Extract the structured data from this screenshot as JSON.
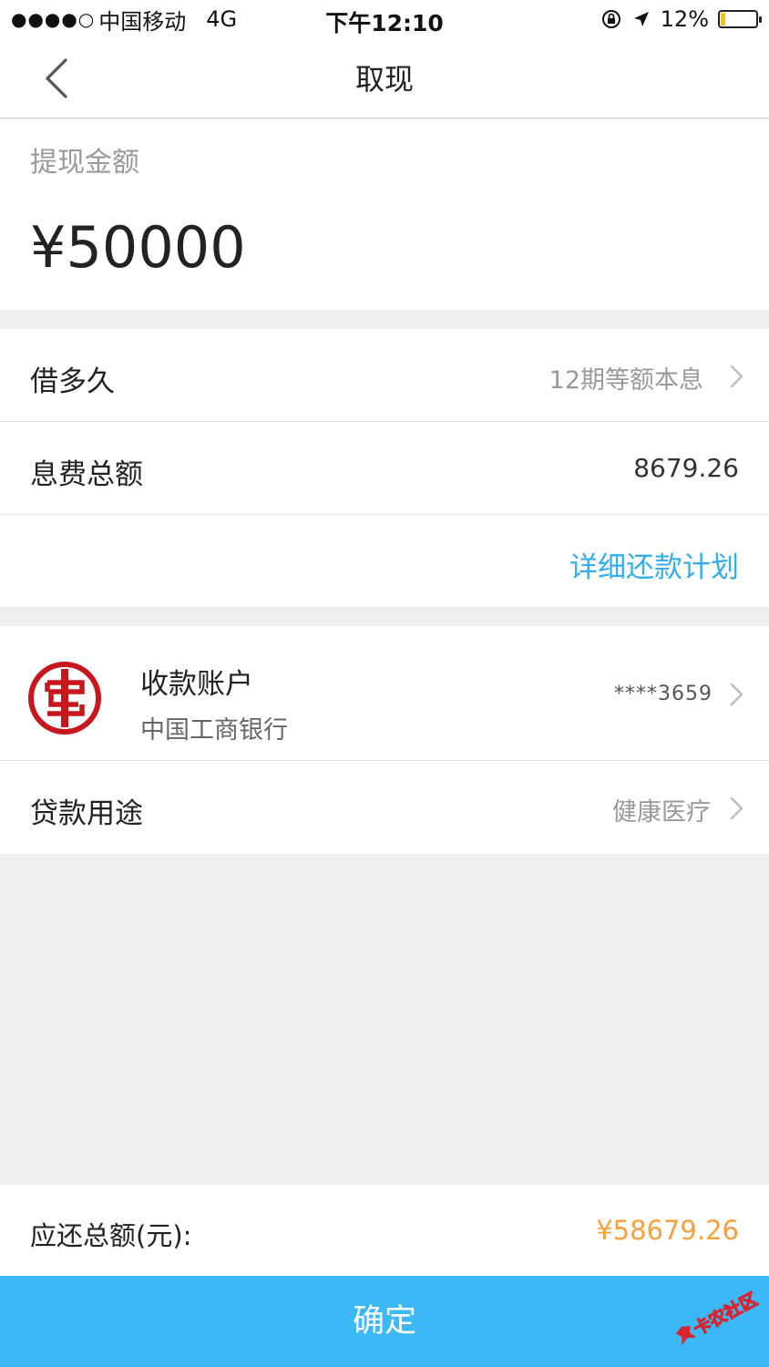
{
  "status_bar": {
    "signal": "●●●●○",
    "carrier": "中国移动",
    "network": "4G",
    "time": "下午12:10",
    "battery_percent": "12%",
    "battery_level": 0.12
  },
  "nav": {
    "title": "取现"
  },
  "withdraw": {
    "label": "提现金额",
    "amount": "¥50000"
  },
  "loan_info": {
    "term_label": "借多久",
    "term_value": "12期等额本息",
    "interest_label": "息费总额",
    "interest_value": "8679.26",
    "plan_link": "详细还款计划"
  },
  "account": {
    "label": "收款账户",
    "bank_name": "中国工商银行",
    "account_number": "****3659",
    "bank_logo_icon": "icbc-logo-icon",
    "purpose_label": "贷款用途",
    "purpose_value": "健康医疗"
  },
  "total": {
    "label": "应还总额(元):",
    "value": "¥58679.26"
  },
  "confirm_button": "确定",
  "watermark": {
    "text": "卡农社区"
  },
  "colors": {
    "accent_blue": "#3bb8f5",
    "link_blue": "#32aef0",
    "total_orange": "#f7a13c",
    "icbc_red": "#c8161d"
  }
}
